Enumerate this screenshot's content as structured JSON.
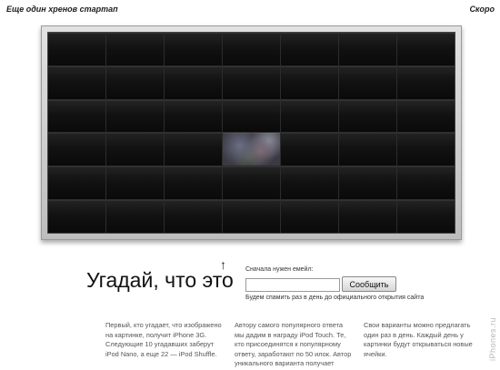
{
  "header": {
    "left_title": "Еще один хренов стартап",
    "right_label": "Скоро"
  },
  "puzzle": {
    "rows": 6,
    "columns": 7,
    "revealed_tile": {
      "row": 4,
      "column": 4
    }
  },
  "guess": {
    "arrow": "↑",
    "headline": "Угадай, что это",
    "email_label": "Сначала нужен емейл:",
    "email_value": "",
    "email_placeholder": "",
    "submit_label": "Сообщить",
    "email_note": "Будем спамить раз в день до официального открытия сайта"
  },
  "columns": [
    {
      "text": "Первый, кто угадает, что изображено на картинке, получит iPhone 3G. Следующие 10 угадавших заберут iPod Nano, а еще 22 — iPod Shuffle."
    },
    {
      "text": "Автору самого популярного ответа мы дадим в награду iPod Touch. Те, кто присоединятся к популярному ответу, заработают по 50 илок. Автор уникального варианта получает"
    },
    {
      "text": "Свои варианты можно предлагать один раз в день. Каждый день у картинки будут открываться новые ячейки."
    }
  ],
  "watermark": "iPhones.ru",
  "colors": {
    "tile_dark": "#121212",
    "frame": "#cfcfcf",
    "background": "#ffffff"
  }
}
